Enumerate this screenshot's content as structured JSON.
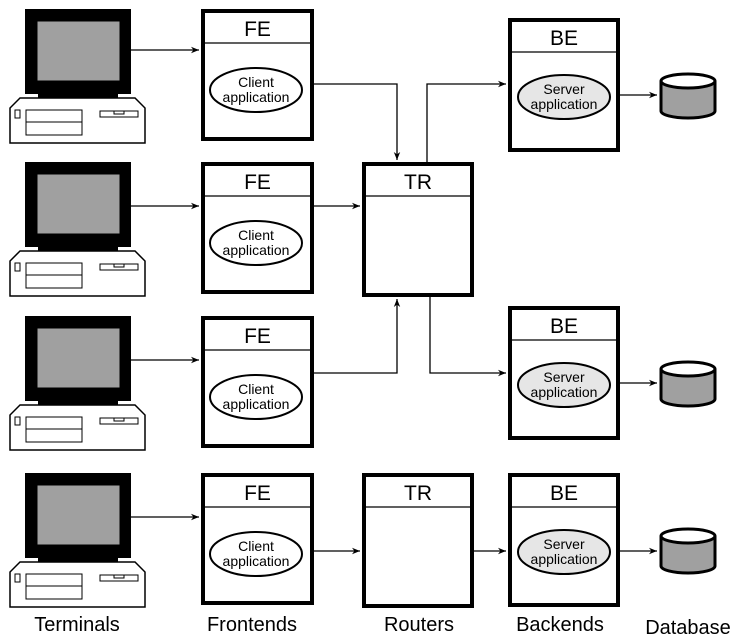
{
  "frontend": {
    "title": "FE",
    "app_line1": "Client",
    "app_line2": "application"
  },
  "router": {
    "title": "TR"
  },
  "backend": {
    "title": "BE",
    "app_line1": "Server",
    "app_line2": "application"
  },
  "column_labels": {
    "terminals": "Terminals",
    "frontends": "Frontends",
    "routers": "Routers",
    "backends": "Backends",
    "database": "Database"
  },
  "colors": {
    "screen": "#a0a0a0",
    "server_app": "#e6e6e6",
    "database": "#a0a0a0"
  }
}
